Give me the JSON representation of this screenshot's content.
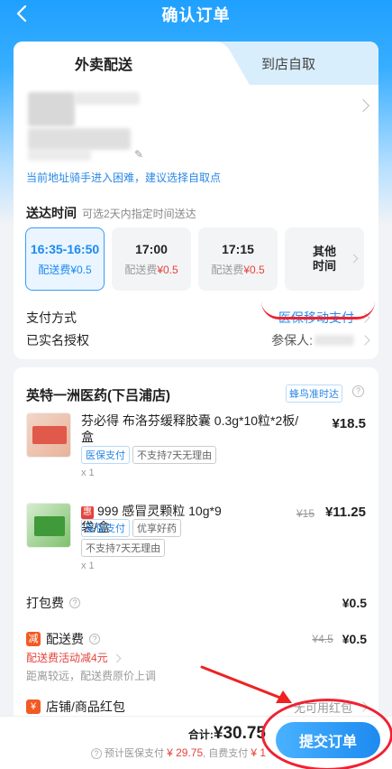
{
  "header": {
    "title": "确认订单"
  },
  "tabs": {
    "delivery": "外卖配送",
    "pickup": "到店自取"
  },
  "address": {
    "tip": "当前地址骑手进入困难，建议选择自取点"
  },
  "delivery_time": {
    "label": "送达时间",
    "sub": "可选2天内指定时间送达",
    "slots": [
      {
        "time": "16:35-16:50",
        "fee_label": "配送费",
        "fee": "¥0.5"
      },
      {
        "time": "17:00",
        "fee_label": "配送费",
        "fee": "¥0.5"
      },
      {
        "time": "17:15",
        "fee_label": "配送费",
        "fee": "¥0.5"
      },
      {
        "time_line1": "其他",
        "time_line2": "时间"
      }
    ]
  },
  "payment": {
    "label": "支付方式",
    "value": "医保移动支付"
  },
  "auth": {
    "label": "已实名授权",
    "value": "参保人:"
  },
  "store": {
    "name": "英特一洲医药(下吕浦店)",
    "delivery_tag": "蜂鸟准时达"
  },
  "products": [
    {
      "name": "芬必得 布洛芬缓释胶囊 0.3g*10粒*2板/盒",
      "price": "¥18.5",
      "tags": [
        "医保支付",
        "不支持7天无理由"
      ],
      "qty": "x 1"
    },
    {
      "badge": "惠",
      "name": "999 感冒灵颗粒 10g*9袋/盒",
      "old_price": "¥15",
      "price": "¥11.25",
      "tags": [
        "医保支付",
        "优享好药",
        "不支持7天无理由"
      ],
      "qty": "x 1"
    }
  ],
  "packing": {
    "label": "打包费",
    "amount": "¥0.5"
  },
  "delivery_fee": {
    "badge": "减",
    "label": "配送费",
    "old_amount": "¥4.5",
    "amount": "¥0.5",
    "promo": "配送费活动减4元",
    "note": "距离较远，配送费原价上调"
  },
  "redpacket": {
    "badge": "¥",
    "label": "店铺/商品红包",
    "value": "无可用红包"
  },
  "footer": {
    "total_label": "合计:",
    "total": "¥30.75",
    "ybsub_label": "预计医保支付",
    "ybsub_amount": "¥ 29.75",
    "self_label": "自费支付",
    "self_amount": "¥ 1",
    "submit": "提交订单"
  },
  "colors": {
    "accent": "#1d8af0",
    "price_red": "#e5433b",
    "annotation": "#e22"
  }
}
